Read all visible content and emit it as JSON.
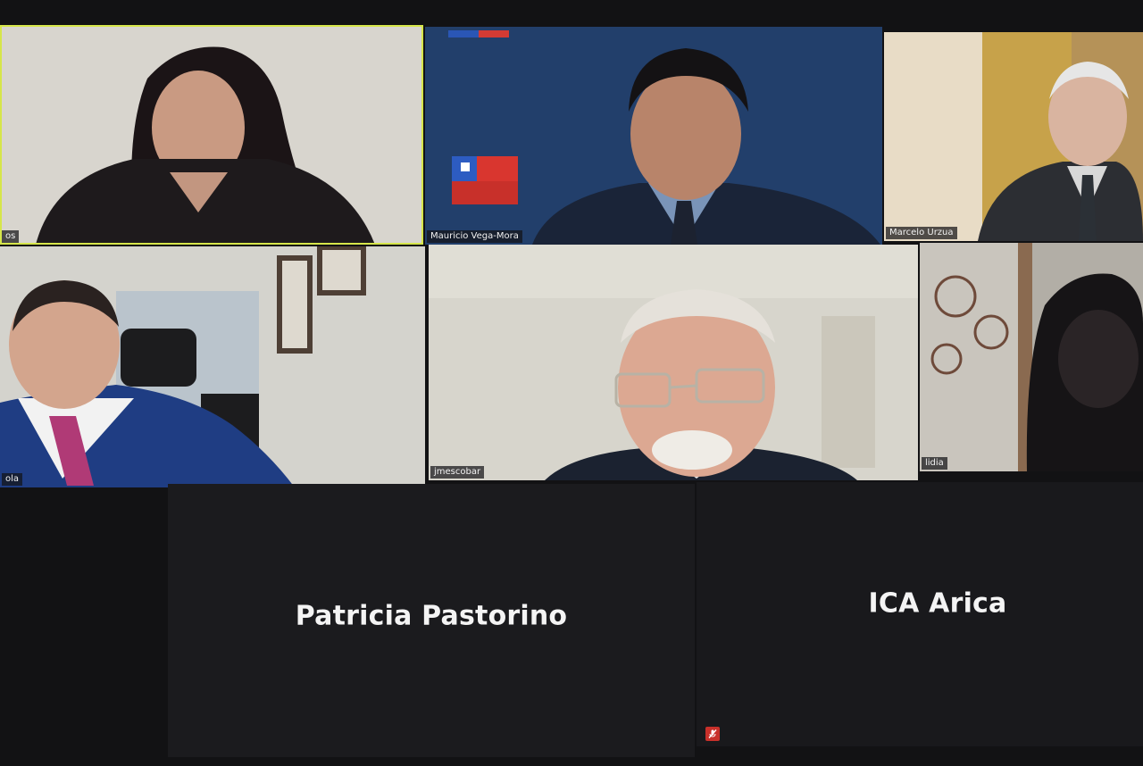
{
  "app": "Zoom meeting - gallery view",
  "participants": [
    {
      "display_name": "os",
      "video": "on",
      "active_speaker": true
    },
    {
      "display_name": "Mauricio Vega-Mora",
      "video": "on"
    },
    {
      "display_name": "Marcelo Urzua",
      "video": "on"
    },
    {
      "display_name": "ola",
      "video": "on"
    },
    {
      "display_name": "jmescobar",
      "video": "on"
    },
    {
      "display_name": "lidia",
      "video": "on"
    },
    {
      "display_name": "Patricia Pastorino",
      "video": "off"
    },
    {
      "display_name": "ICA Arica",
      "video": "off",
      "muted": true
    }
  ],
  "icons": {
    "muted": "microphone-muted-icon"
  },
  "colors": {
    "active_speaker_border": "#d6e64a",
    "muted_icon": "#c8302a"
  }
}
